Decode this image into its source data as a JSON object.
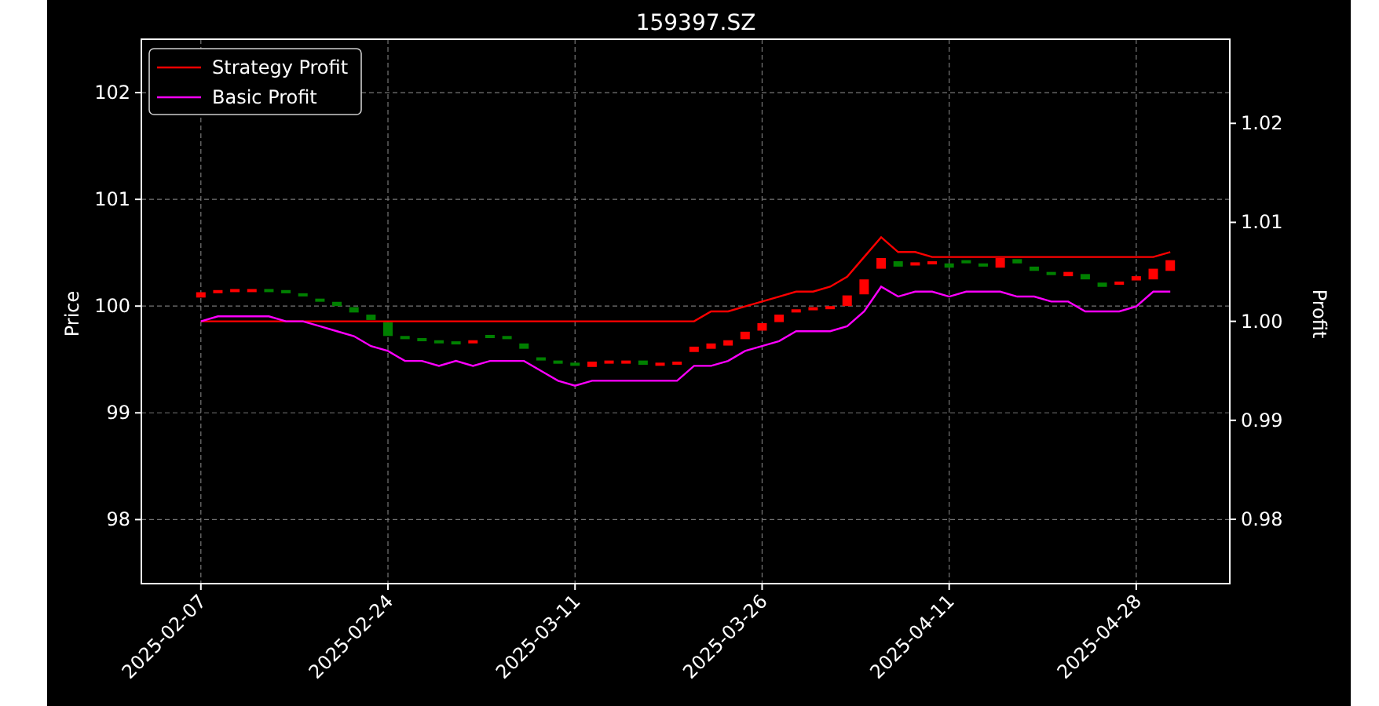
{
  "price_axis": {
    "label": "Price",
    "ticks": [
      "102",
      "101",
      "100",
      "99",
      "98"
    ]
  },
  "chart": {
    "chart_data": {
      "type": "line",
      "title": "159397.SZ",
      "ylabel": "Profit",
      "grid": true,
      "legend": true,
      "categories": [
        null,
        null,
        null,
        "2025-02-07",
        null,
        null,
        null,
        null,
        null,
        null,
        null,
        null,
        null,
        null,
        "2025-02-24",
        null,
        null,
        null,
        null,
        null,
        null,
        null,
        null,
        null,
        null,
        "2025-03-11",
        null,
        null,
        null,
        null,
        null,
        null,
        null,
        null,
        null,
        null,
        "2025-03-26",
        null,
        null,
        null,
        null,
        null,
        null,
        null,
        null,
        null,
        null,
        "2025-04-11",
        null,
        null,
        null,
        null,
        null,
        null,
        null,
        null,
        null,
        null,
        "2025-04-28",
        null,
        null,
        null,
        null,
        null
      ],
      "ylim": [
        0.9735,
        1.0285
      ],
      "yticks": [
        {
          "value": 0.98,
          "label": "0.98"
        },
        {
          "value": 0.99,
          "label": "0.99"
        },
        {
          "value": 1.0,
          "label": "1.00"
        },
        {
          "value": 1.01,
          "label": "1.01"
        },
        {
          "value": 1.02,
          "label": "1.02"
        }
      ],
      "series": [
        {
          "name": "Strategy Profit",
          "color": "#ff0000",
          "values": [
            null,
            null,
            null,
            1.0,
            1.0,
            1.0,
            1.0,
            1.0,
            1.0,
            1.0,
            1.0,
            1.0,
            1.0,
            1.0,
            1.0,
            1.0,
            1.0,
            1.0,
            1.0,
            1.0,
            1.0,
            1.0,
            1.0,
            1.0,
            1.0,
            1.0,
            1.0,
            1.0,
            1.0,
            1.0,
            1.0,
            1.0,
            1.0,
            1.001,
            1.001,
            1.0015,
            1.002,
            1.0025,
            1.003,
            1.003,
            1.0035,
            1.0045,
            1.0065,
            1.0085,
            1.007,
            1.007,
            1.0065,
            1.0065,
            1.0065,
            1.0065,
            1.0065,
            1.0065,
            1.0065,
            1.0065,
            1.0065,
            1.0065,
            1.0065,
            1.0065,
            1.0065,
            1.0065,
            1.007,
            null,
            null,
            null
          ]
        },
        {
          "name": "Basic Profit",
          "color": "#ff00ff",
          "values": [
            null,
            null,
            null,
            1.0,
            1.0005,
            1.0005,
            1.0005,
            1.0005,
            1.0,
            1.0,
            0.9995,
            0.999,
            0.9985,
            0.9975,
            0.997,
            0.996,
            0.996,
            0.9955,
            0.996,
            0.9955,
            0.996,
            0.996,
            0.996,
            0.995,
            0.994,
            0.9935,
            0.994,
            0.994,
            0.994,
            0.994,
            0.994,
            0.994,
            0.9955,
            0.9955,
            0.996,
            0.997,
            0.9975,
            0.998,
            0.999,
            0.999,
            0.999,
            0.9995,
            1.001,
            1.0035,
            1.0025,
            1.003,
            1.003,
            1.0025,
            1.003,
            1.003,
            1.003,
            1.0025,
            1.0025,
            1.002,
            1.002,
            1.001,
            1.001,
            1.001,
            1.0015,
            1.003,
            1.003,
            null,
            null,
            null
          ]
        }
      ]
    }
  }
}
